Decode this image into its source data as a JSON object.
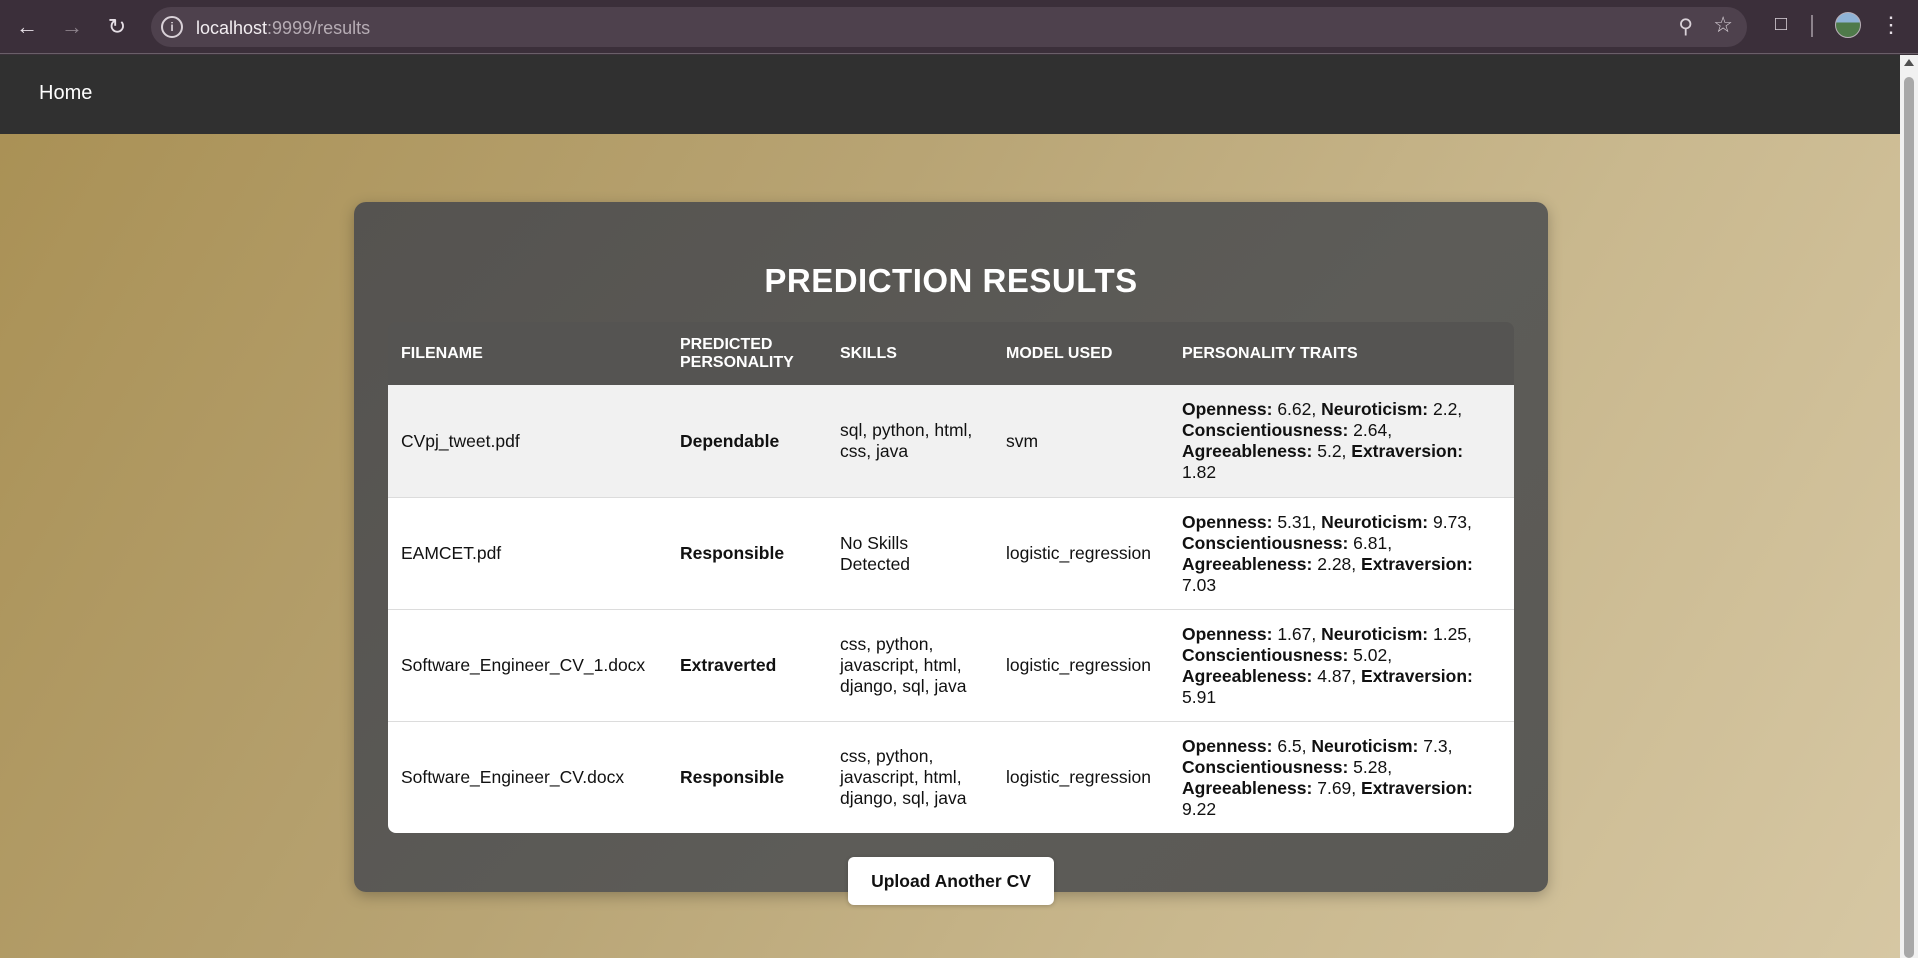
{
  "browser": {
    "url_host": "localhost",
    "url_path": ":9999/results"
  },
  "nav": {
    "home_label": "Home"
  },
  "results": {
    "title": "PREDICTION RESULTS",
    "columns": [
      "FILENAME",
      "PREDICTED PERSONALITY",
      "SKILLS",
      "MODEL USED",
      "PERSONALITY TRAITS"
    ],
    "trait_labels": {
      "openness": "Openness:",
      "neuroticism": "Neuroticism:",
      "conscientiousness": "Conscientiousness:",
      "agreeableness": "Agreeableness:",
      "extraversion": "Extraversion:"
    },
    "rows": [
      {
        "filename": "CVpj_tweet.pdf",
        "personality": "Dependable",
        "skills": "sql, python, html, css, java",
        "model": "svm",
        "traits": {
          "openness": "6.62",
          "neuroticism": "2.2",
          "conscientiousness": "2.64",
          "agreeableness": "5.2",
          "extraversion": "1.82"
        }
      },
      {
        "filename": "EAMCET.pdf",
        "personality": "Responsible",
        "skills": "No Skills Detected",
        "model": "logistic_regression",
        "traits": {
          "openness": "5.31",
          "neuroticism": "9.73",
          "conscientiousness": "6.81",
          "agreeableness": "2.28",
          "extraversion": "7.03"
        }
      },
      {
        "filename": "Software_Engineer_CV_1.docx",
        "personality": "Extraverted",
        "skills": "css, python, javascript, html, django, sql, java",
        "model": "logistic_regression",
        "traits": {
          "openness": "1.67",
          "neuroticism": "1.25",
          "conscientiousness": "5.02",
          "agreeableness": "4.87",
          "extraversion": "5.91"
        }
      },
      {
        "filename": "Software_Engineer_CV.docx",
        "personality": "Responsible",
        "skills": "css, python, javascript, html, django, sql, java",
        "model": "logistic_regression",
        "traits": {
          "openness": "6.5",
          "neuroticism": "7.3",
          "conscientiousness": "5.28",
          "agreeableness": "7.69",
          "extraversion": "9.22"
        }
      }
    ],
    "upload_label": "Upload Another CV"
  }
}
